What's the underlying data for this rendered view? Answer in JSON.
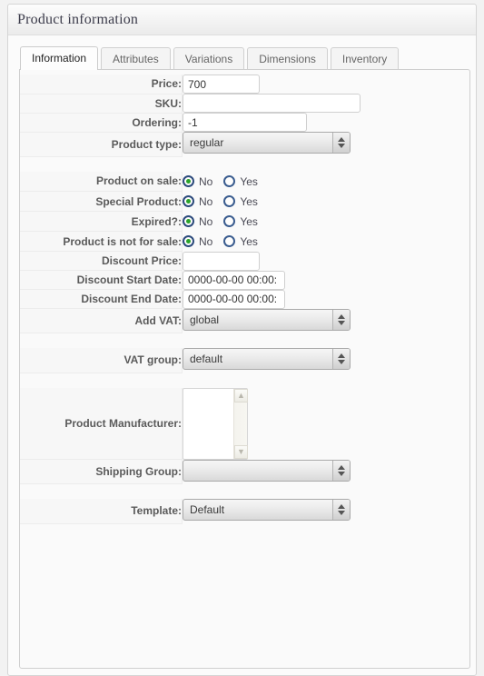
{
  "window": {
    "title": "Product information"
  },
  "tabs": [
    {
      "label": "Information",
      "active": true
    },
    {
      "label": "Attributes",
      "active": false
    },
    {
      "label": "Variations",
      "active": false
    },
    {
      "label": "Dimensions",
      "active": false
    },
    {
      "label": "Inventory",
      "active": false
    }
  ],
  "form": {
    "price": {
      "label": "Price:",
      "value": "700",
      "placeholder": ""
    },
    "sku": {
      "label": "SKU:",
      "value": "",
      "placeholder": ""
    },
    "ordering": {
      "label": "Ordering:",
      "value": "-1",
      "placeholder": ""
    },
    "product_type": {
      "label": "Product type:",
      "value": "regular"
    },
    "on_sale": {
      "label": "Product on sale:",
      "selected": "No"
    },
    "special": {
      "label": "Special Product:",
      "selected": "No"
    },
    "expired": {
      "label": "Expired?:",
      "selected": "No"
    },
    "not_for_sale": {
      "label": "Product is not for sale:",
      "selected": "No"
    },
    "discount_price": {
      "label": "Discount Price:",
      "value": "",
      "placeholder": ""
    },
    "discount_start": {
      "label": "Discount Start Date:",
      "value": "0000-00-00 00:00:"
    },
    "discount_end": {
      "label": "Discount End Date:",
      "value": "0000-00-00 00:00:"
    },
    "add_vat": {
      "label": "Add VAT:",
      "value": "global"
    },
    "vat_group": {
      "label": "VAT group:",
      "value": "default"
    },
    "manufacturer": {
      "label": "Product Manufacturer:",
      "value": ""
    },
    "shipping_group": {
      "label": "Shipping Group:",
      "value": ""
    },
    "template": {
      "label": "Template:",
      "value": "Default"
    }
  },
  "radio_options": {
    "no": "No",
    "yes": "Yes"
  },
  "icons": {
    "spinner_up": "triangle-up-icon",
    "spinner_down": "triangle-down-icon",
    "scroll_up": "chevron-up-icon",
    "scroll_down": "chevron-down-icon"
  },
  "colors": {
    "radio_ring": "#2c4a7c",
    "radio_dot": "#2aa32a",
    "panel_bg": "#fafafa",
    "label_bg": "#f7f7f7"
  }
}
